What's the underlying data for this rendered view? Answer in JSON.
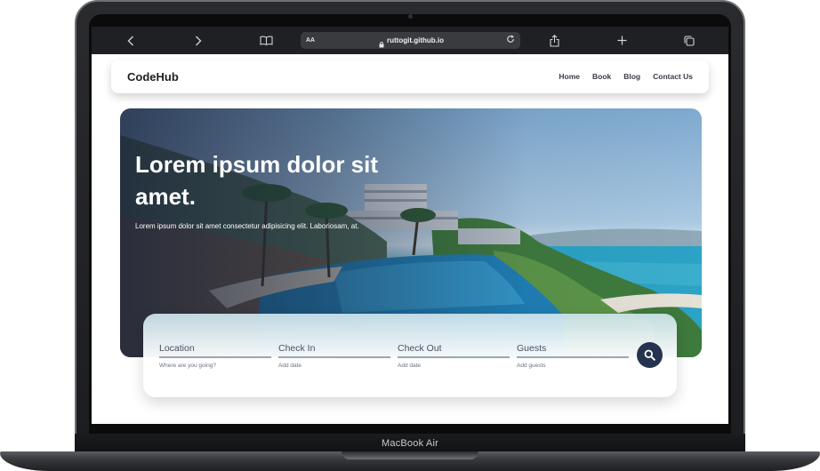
{
  "device": {
    "label": "MacBook Air"
  },
  "browser": {
    "url": "ruttogit.github.io",
    "aa_label": "AA",
    "icons": [
      "back-icon",
      "forward-icon",
      "reader-book-icon",
      "lock-icon",
      "reload-icon",
      "share-icon",
      "new-tab-icon",
      "tabs-icon"
    ]
  },
  "site": {
    "brand": "CodeHub",
    "nav": [
      "Home",
      "Book",
      "Blog",
      "Contact Us"
    ]
  },
  "hero": {
    "title": "Lorem ipsum dolor sit amet.",
    "subtitle": "Lorem ipsum dolor sit amet consectetur adipisicing elit. Laboriosam, at."
  },
  "search": {
    "fields": [
      {
        "label": "Location",
        "hint": "Where are you going?"
      },
      {
        "label": "Check In",
        "hint": "Add date"
      },
      {
        "label": "Check Out",
        "hint": "Add date"
      },
      {
        "label": "Guests",
        "hint": "Add guests"
      }
    ],
    "button_icon": "search-icon"
  },
  "colors": {
    "accent": "#263350",
    "toolbar": "#1f2023",
    "text_dark": "#1d1f24"
  }
}
